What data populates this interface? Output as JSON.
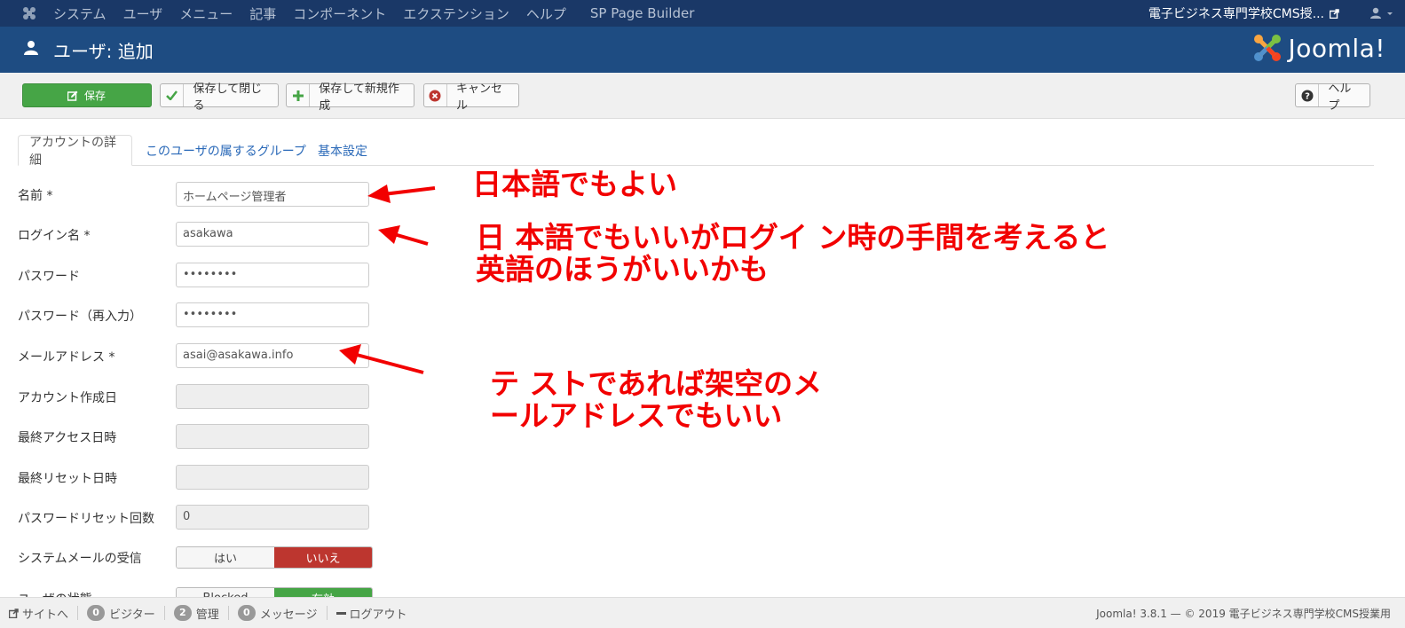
{
  "topnav": {
    "items": [
      "システム",
      "ユーザ",
      "メニュー",
      "記事",
      "コンポーネント",
      "エクステンション",
      "ヘルプ"
    ],
    "sp_builder": "SP Page Builder",
    "site_name": "電子ビジネス専門学校CMS授..."
  },
  "header": {
    "title": "ユーザ: 追加",
    "brand": "Joomla!"
  },
  "toolbar": {
    "save": "保存",
    "save_close": "保存して閉じる",
    "save_new": "保存して新規作成",
    "cancel": "キャンセル",
    "help": "ヘルプ"
  },
  "tabs": [
    "アカウントの詳細",
    "このユーザの属するグループ",
    "基本設定"
  ],
  "form": {
    "name_label": "名前 *",
    "name_value": "ホームページ管理者",
    "login_label": "ログイン名 *",
    "login_value": "asakawa",
    "password_label": "パスワード",
    "password_value": "••••••••",
    "password2_label": "パスワード（再入力）",
    "password2_value": "••••••••",
    "email_label": "メールアドレス *",
    "email_value": "asai@asakawa.info",
    "created_label": "アカウント作成日",
    "lastvisit_label": "最終アクセス日時",
    "lastreset_label": "最終リセット日時",
    "resetcount_label": "パスワードリセット回数",
    "resetcount_value": "0",
    "sendmail_label": "システムメールの受信",
    "sendmail_yes": "はい",
    "sendmail_no": "いいえ",
    "block_label": "ユーザの状態",
    "block_blocked": "Blocked",
    "block_enabled": "有効"
  },
  "annotations": {
    "note1": "日本語でもよい",
    "note2_line1": "日 本語でもいいがログイ ン時の手間を考えると",
    "note2_line2": "英語のほうがいいかも",
    "note3_line1": "テ ストであれば架空のメ",
    "note3_line2": "ールアドレスでもいい"
  },
  "statusbar": {
    "site": "サイトへ",
    "visitors_count": "0",
    "visitors": "ビジター",
    "admins_count": "2",
    "admins": "管理",
    "messages_count": "0",
    "messages": "メッセージ",
    "logout": "ログアウト",
    "copyright": "Joomla! 3.8.1 — © 2019 電子ビジネス専門学校CMS授業用"
  },
  "colors": {
    "topnav_bg": "#1a3867",
    "header_bg": "#1e4c82",
    "save_green": "#46a546",
    "no_red": "#bd362f",
    "annotation_red": "#f20000"
  }
}
